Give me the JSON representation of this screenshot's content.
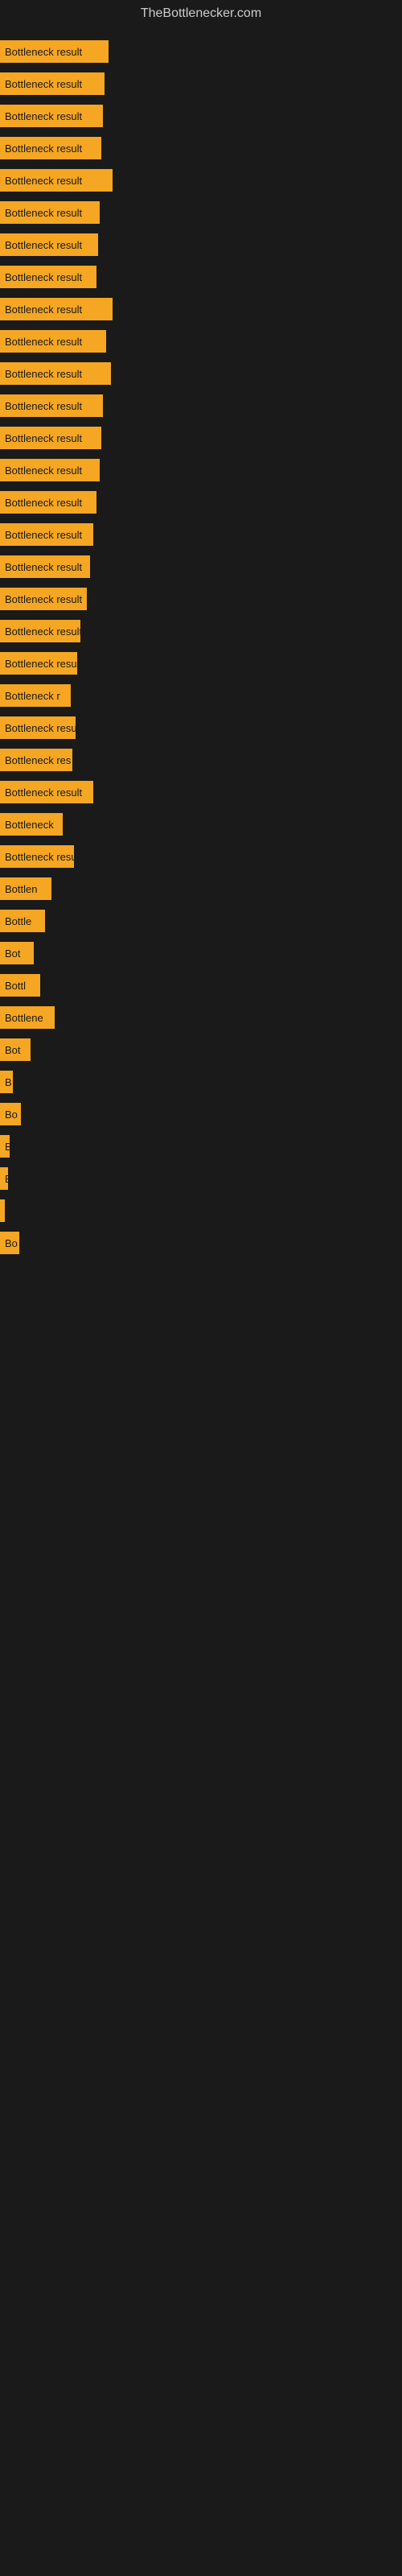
{
  "site_title": "TheBottlenecker.com",
  "bars": [
    {
      "label": "Bottleneck result",
      "width": 135
    },
    {
      "label": "Bottleneck result",
      "width": 130
    },
    {
      "label": "Bottleneck result",
      "width": 128
    },
    {
      "label": "Bottleneck result",
      "width": 126
    },
    {
      "label": "Bottleneck result",
      "width": 140
    },
    {
      "label": "Bottleneck result",
      "width": 124
    },
    {
      "label": "Bottleneck result",
      "width": 122
    },
    {
      "label": "Bottleneck result",
      "width": 120
    },
    {
      "label": "Bottleneck result",
      "width": 140
    },
    {
      "label": "Bottleneck result",
      "width": 132
    },
    {
      "label": "Bottleneck result",
      "width": 138
    },
    {
      "label": "Bottleneck result",
      "width": 128
    },
    {
      "label": "Bottleneck result",
      "width": 126
    },
    {
      "label": "Bottleneck result",
      "width": 124
    },
    {
      "label": "Bottleneck result",
      "width": 120
    },
    {
      "label": "Bottleneck result",
      "width": 116
    },
    {
      "label": "Bottleneck result",
      "width": 112
    },
    {
      "label": "Bottleneck result",
      "width": 108
    },
    {
      "label": "Bottleneck result",
      "width": 100
    },
    {
      "label": "Bottleneck resu",
      "width": 96
    },
    {
      "label": "Bottleneck r",
      "width": 88
    },
    {
      "label": "Bottleneck resu",
      "width": 94
    },
    {
      "label": "Bottleneck res",
      "width": 90
    },
    {
      "label": "Bottleneck result",
      "width": 116
    },
    {
      "label": "Bottleneck",
      "width": 78
    },
    {
      "label": "Bottleneck resu",
      "width": 92
    },
    {
      "label": "Bottlen",
      "width": 64
    },
    {
      "label": "Bottle",
      "width": 56
    },
    {
      "label": "Bot",
      "width": 42
    },
    {
      "label": "Bottl",
      "width": 50
    },
    {
      "label": "Bottlene",
      "width": 68
    },
    {
      "label": "Bot",
      "width": 38
    },
    {
      "label": "B",
      "width": 16
    },
    {
      "label": "Bo",
      "width": 26
    },
    {
      "label": "B",
      "width": 12
    },
    {
      "label": "B",
      "width": 10
    },
    {
      "label": "",
      "width": 6
    },
    {
      "label": "Bo",
      "width": 24
    }
  ]
}
